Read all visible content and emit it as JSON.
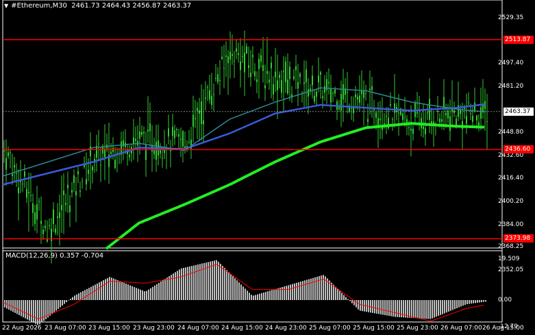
{
  "header": {
    "symbol": "#Ethereum,M30",
    "ohlc": "2461.73 2464.43 2456.87 2463.37"
  },
  "macd": {
    "label": "MACD(12,26,9) 0.357 -0.704",
    "ticks": [
      "19.509",
      "0.00",
      "-12.79"
    ]
  },
  "price_axis": {
    "ticks": [
      "2529.35",
      "2497.40",
      "2481.20",
      "2448.80",
      "2432.60",
      "2416.40",
      "2400.20",
      "2384.00",
      "2368.25",
      "2352.05"
    ],
    "current_price": "2463.37",
    "levels": [
      "2513.87",
      "2436.60",
      "2373.98"
    ]
  },
  "time_axis": {
    "labels": [
      "22 Aug 2026",
      "23 Aug 07:00",
      "23 Aug 15:00",
      "23 Aug 23:00",
      "24 Aug 07:00",
      "24 Aug 15:00",
      "24 Aug 23:00",
      "25 Aug 07:00",
      "25 Aug 15:00",
      "25 Aug 23:00",
      "26 Aug 07:00",
      "26 Aug 15:00"
    ]
  },
  "colors": {
    "background": "#000000",
    "candle": "#32cd32",
    "ma_slow": "#22ee22",
    "ma_mid": "#3a5bdc",
    "ma_fast": "#2a8c92",
    "level_line": "#ff0000",
    "macd_hist": "#c0c0c0",
    "macd_signal": "#ff0000"
  },
  "chart_data": {
    "type": "line",
    "instrument": "#Ethereum",
    "timeframe": "M30",
    "ylim": [
      2352.05,
      2535.0
    ],
    "x": [
      "22 Aug 2026",
      "23 Aug 07:00",
      "23 Aug 15:00",
      "23 Aug 23:00",
      "24 Aug 07:00",
      "24 Aug 15:00",
      "24 Aug 23:00",
      "25 Aug 07:00",
      "25 Aug 15:00",
      "25 Aug 23:00",
      "26 Aug 07:00",
      "26 Aug 15:00"
    ],
    "series": [
      {
        "values": [
          2438,
          2380,
          2430,
          2445,
          2440,
          2505,
          2488,
          2478,
          2470,
          2455,
          2462,
          2463
        ]
      },
      {
        "values": [
          2412,
          2420,
          2428,
          2438,
          2437,
          2448,
          2462,
          2468,
          2466,
          2464,
          2466,
          2470
        ]
      },
      {
        "values": [
          2418,
          2428,
          2438,
          2441,
          2436,
          2458,
          2470,
          2480,
          2478,
          2470,
          2465,
          2462
        ]
      },
      {
        "values": [
          2300,
          2330,
          2360,
          2385,
          2398,
          2412,
          2428,
          2442,
          2452,
          2455,
          2453,
          2452
        ]
      }
    ],
    "macd_values": [
      -3,
      -12,
      2,
      11,
      4,
      15,
      19,
      2,
      7,
      12,
      -5,
      -8,
      -9,
      -2,
      0.357
    ],
    "macd_signal": [
      -1,
      -9,
      -2,
      9,
      8,
      11,
      17,
      5,
      5,
      10,
      -2,
      -6,
      -10,
      -4,
      -0.704
    ]
  }
}
